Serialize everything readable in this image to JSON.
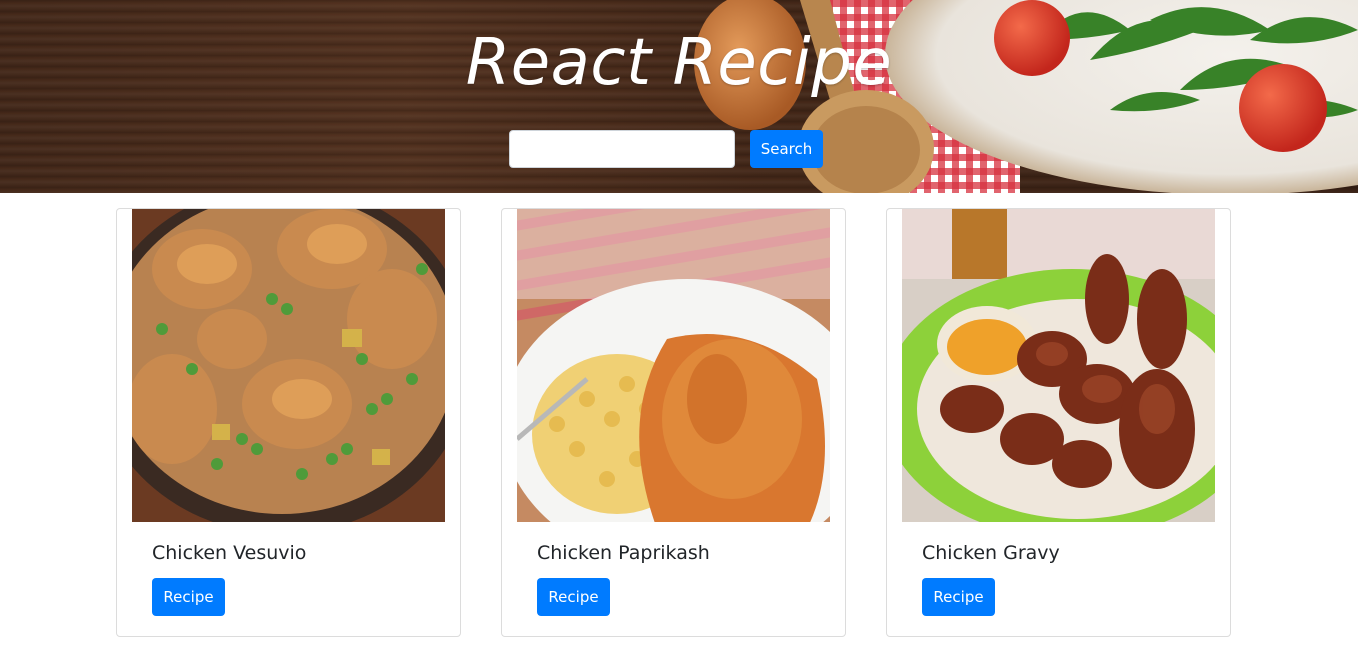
{
  "header": {
    "title": "React Recipe",
    "search": {
      "value": "",
      "placeholder": ""
    },
    "search_button_label": "Search"
  },
  "recipes": [
    {
      "title": "Chicken Vesuvio",
      "button_label": "Recipe"
    },
    {
      "title": "Chicken Paprikash",
      "button_label": "Recipe"
    },
    {
      "title": "Chicken Gravy",
      "button_label": "Recipe"
    }
  ],
  "colors": {
    "primary": "#007bff",
    "wood": "#4a2c1c",
    "card_border": "#dcdcdc"
  }
}
